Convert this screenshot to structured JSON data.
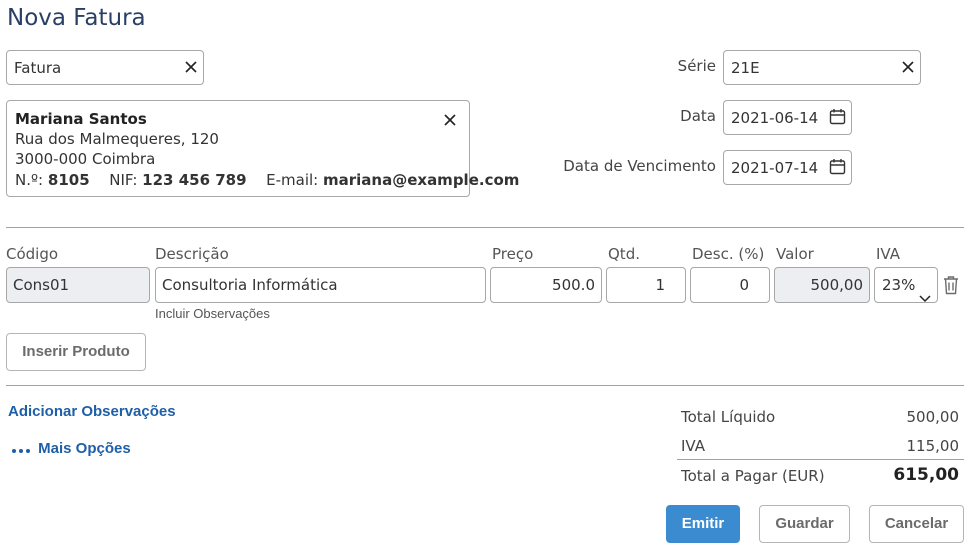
{
  "page": {
    "title": "Nova Fatura"
  },
  "doc_type": {
    "value": "Fatura"
  },
  "client": {
    "name": "Mariana Santos",
    "address": "Rua dos Malmequeres, 120",
    "postal": "3000-000 Coimbra",
    "number_label": "N.º:",
    "number": "8105",
    "nif_label": "NIF:",
    "nif": "123 456 789",
    "email_label": "E-mail:",
    "email": "mariana@example.com"
  },
  "serie": {
    "label": "Série",
    "value": "21E"
  },
  "date": {
    "label": "Data",
    "value": "2021-06-14"
  },
  "due_date": {
    "label": "Data de Vencimento",
    "value": "2021-07-14"
  },
  "table": {
    "headers": {
      "code": "Código",
      "description": "Descrição",
      "price": "Preço",
      "qty": "Qtd.",
      "discount": "Desc. (%)",
      "value": "Valor",
      "vat": "IVA"
    },
    "row": {
      "code": "Cons01",
      "description": "Consultoria Informática",
      "price": "500.0",
      "qty": "1",
      "discount": "0",
      "value": "500,00",
      "vat": "23%"
    },
    "include_notes": "Incluir Observações"
  },
  "insert_product": "Inserir Produto",
  "add_notes": "Adicionar Observações",
  "more_options": "Mais Opções",
  "totals": {
    "net_label": "Total Líquido",
    "net": "500,00",
    "vat_label": "IVA",
    "vat": "115,00",
    "total_label": "Total a Pagar (EUR)",
    "total": "615,00"
  },
  "actions": {
    "emit": "Emitir",
    "save": "Guardar",
    "cancel": "Cancelar"
  },
  "colors": {
    "title": "#2a3f66",
    "link": "#1f5fa8",
    "primary": "#3a8bd0"
  }
}
